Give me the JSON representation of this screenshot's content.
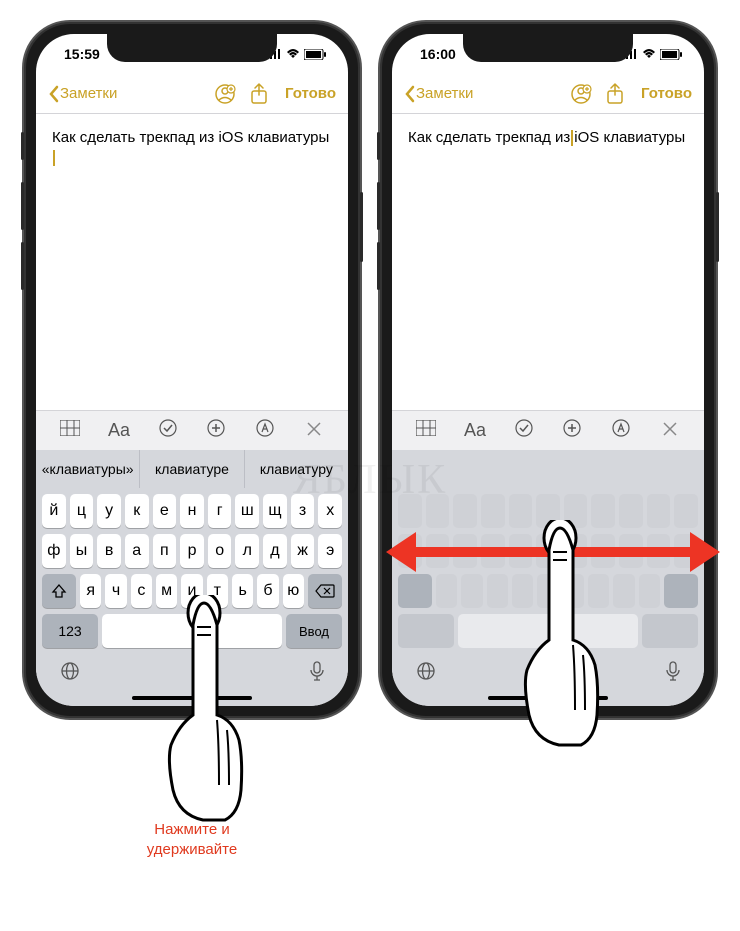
{
  "watermark": "ЯБЛЫК",
  "instruction_line1": "Нажмите и",
  "instruction_line2": "удерживайте",
  "phone1": {
    "time": "15:59",
    "back": "Заметки",
    "done": "Готово",
    "note_text": "Как сделать трекпад из iOS клавиатуры",
    "format_aa": "Aa",
    "suggestions": [
      "«клавиатуры»",
      "клавиатуре",
      "клавиатуру"
    ],
    "rows": [
      [
        "й",
        "ц",
        "у",
        "к",
        "е",
        "н",
        "г",
        "ш",
        "щ",
        "з",
        "х"
      ],
      [
        "ф",
        "ы",
        "в",
        "а",
        "п",
        "р",
        "о",
        "л",
        "д",
        "ж",
        "э"
      ],
      [
        "я",
        "ч",
        "с",
        "м",
        "и",
        "т",
        "ь",
        "б",
        "ю"
      ]
    ],
    "num_key": "123",
    "enter_key": "Ввод"
  },
  "phone2": {
    "time": "16:00",
    "back": "Заметки",
    "done": "Готово",
    "note_before": "Как сделать трекпад из",
    "note_after": "iOS клавиатуры",
    "format_aa": "Aa"
  }
}
